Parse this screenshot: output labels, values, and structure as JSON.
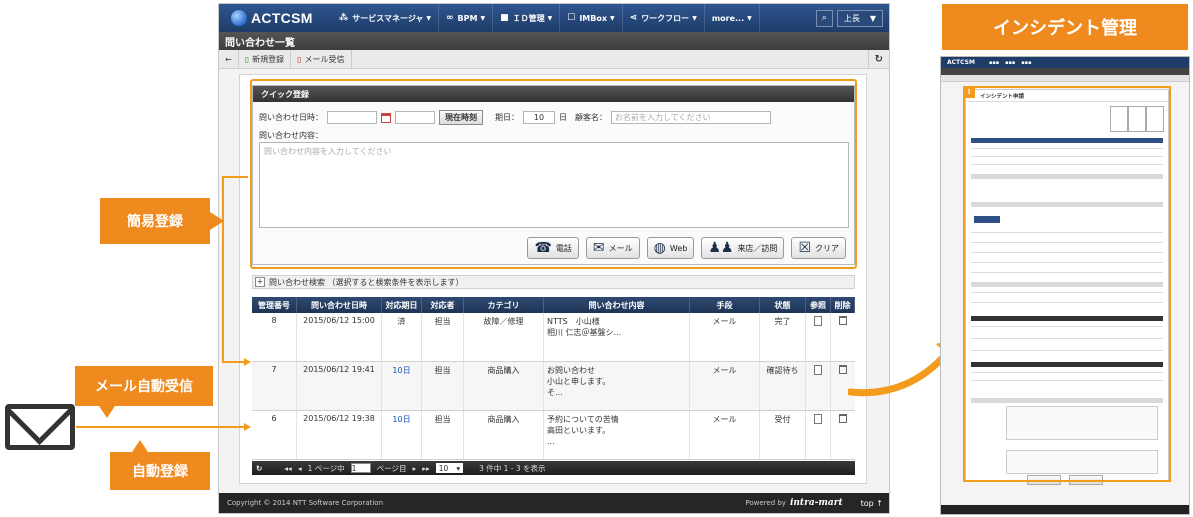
{
  "nav": {
    "logo": "ACTCSM",
    "items": [
      {
        "icon": "gears-icon",
        "label": "サービスマネージャ"
      },
      {
        "icon": "link-icon",
        "label": "BPM"
      },
      {
        "icon": "lock-icon",
        "label": "ＩＤ管理"
      },
      {
        "icon": "inbox-icon",
        "label": "IMBox"
      },
      {
        "icon": "workflow-icon",
        "label": "ワークフロー"
      },
      {
        "icon": "",
        "label": "more..."
      }
    ],
    "user": "上長"
  },
  "page_title": "問い合わせ一覧",
  "toolbar": {
    "new": "新規登録",
    "mail": "メール受信"
  },
  "quick": {
    "header": "クイック登録",
    "datetime_label": "問い合わせ日時：",
    "now_button": "現在時刻",
    "due_label": "期日：",
    "due_value": "10",
    "due_unit": "日",
    "customer_label": "顧客名：",
    "customer_placeholder": "お名前を入力してください",
    "content_label": "問い合わせ内容：",
    "content_placeholder": "問い合わせ内容を入力してください",
    "actions": [
      "電話",
      "メール",
      "Web",
      "来店／訪問",
      "クリア"
    ]
  },
  "search_toggle": "問い合わせ検索 （選択すると検索条件を表示します）",
  "table": {
    "headers": [
      "管理番号",
      "問い合わせ日時",
      "対応期日",
      "対応者",
      "カテゴリ",
      "問い合わせ内容",
      "手段",
      "状態",
      "参照",
      "削除"
    ],
    "rows": [
      {
        "id": "8",
        "datetime": "2015/06/12 15:00",
        "due": "済",
        "assignee": "担当",
        "category": "故障／修理",
        "content": [
          "",
          "NTTS　小山様",
          "",
          "相川 仁志＠基盤シ..."
        ],
        "method": "メール",
        "status": "完了"
      },
      {
        "id": "7",
        "datetime": "2015/06/12 19:41",
        "due": "10日",
        "assignee": "担当",
        "category": "商品購入",
        "content": [
          "お問い合わせ",
          "小山と申します。",
          "",
          "そ..."
        ],
        "method": "メール",
        "status": "確認待ち"
      },
      {
        "id": "6",
        "datetime": "2015/06/12 19:38",
        "due": "10日",
        "assignee": "担当",
        "category": "商品購入",
        "content": [
          "予約についての苦情",
          "高田といいます。",
          "..."
        ],
        "method": "メール",
        "status": "受付"
      }
    ]
  },
  "pager": {
    "page_prefix": "1 ページ中",
    "page_value": "1",
    "page_suffix": "ページ目",
    "page_size": "10",
    "summary": "3 件中 1 - 3 を表示"
  },
  "footer": {
    "copyright": "Copyright © 2014 NTT Software Corporation",
    "powered": "Powered by",
    "brand": "intra-mart",
    "top": "top ↑"
  },
  "callouts": {
    "simple": "簡易登録",
    "mail": "メール自動受信",
    "auto": "自動登録"
  },
  "panel": {
    "banner": "インシデント管理",
    "form_title": "インシデント申請"
  },
  "colors": {
    "accent": "#ef8a1f",
    "nav": "#1e3c68"
  }
}
